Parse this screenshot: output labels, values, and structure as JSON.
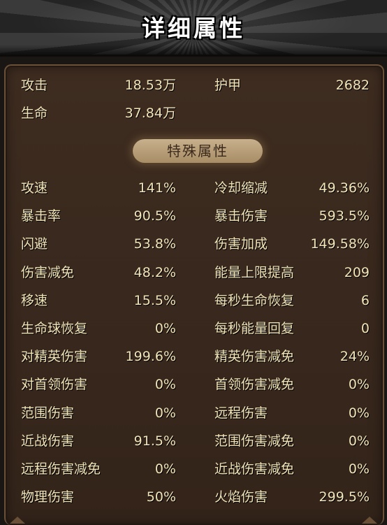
{
  "header": {
    "title": "详细属性"
  },
  "basic": [
    {
      "label": "攻击",
      "value": "18.53万"
    },
    {
      "label": "护甲",
      "value": "2682"
    },
    {
      "label": "生命",
      "value": "37.84万"
    }
  ],
  "special_title": "特殊属性",
  "special": [
    {
      "label": "攻速",
      "value": "141%"
    },
    {
      "label": "冷却缩减",
      "value": "49.36%"
    },
    {
      "label": "暴击率",
      "value": "90.5%"
    },
    {
      "label": "暴击伤害",
      "value": "593.5%"
    },
    {
      "label": "闪避",
      "value": "53.8%"
    },
    {
      "label": "伤害加成",
      "value": "149.58%"
    },
    {
      "label": "伤害减免",
      "value": "48.2%"
    },
    {
      "label": "能量上限提高",
      "value": "209"
    },
    {
      "label": "移速",
      "value": "15.5%"
    },
    {
      "label": "每秒生命恢复",
      "value": "6"
    },
    {
      "label": "生命球恢复",
      "value": "0%"
    },
    {
      "label": "每秒能量回复",
      "value": "0"
    },
    {
      "label": "对精英伤害",
      "value": "199.6%"
    },
    {
      "label": "精英伤害减免",
      "value": "24%"
    },
    {
      "label": "对首领伤害",
      "value": "0%"
    },
    {
      "label": "首领伤害减免",
      "value": "0%"
    },
    {
      "label": "范围伤害",
      "value": "0%"
    },
    {
      "label": "远程伤害",
      "value": "0%"
    },
    {
      "label": "近战伤害",
      "value": "91.5%"
    },
    {
      "label": "范围伤害减免",
      "value": "0%"
    },
    {
      "label": "远程伤害减免",
      "value": "0%"
    },
    {
      "label": "近战伤害减免",
      "value": "0%"
    },
    {
      "label": "物理伤害",
      "value": "50%"
    },
    {
      "label": "火焰伤害",
      "value": "299.5%"
    }
  ]
}
